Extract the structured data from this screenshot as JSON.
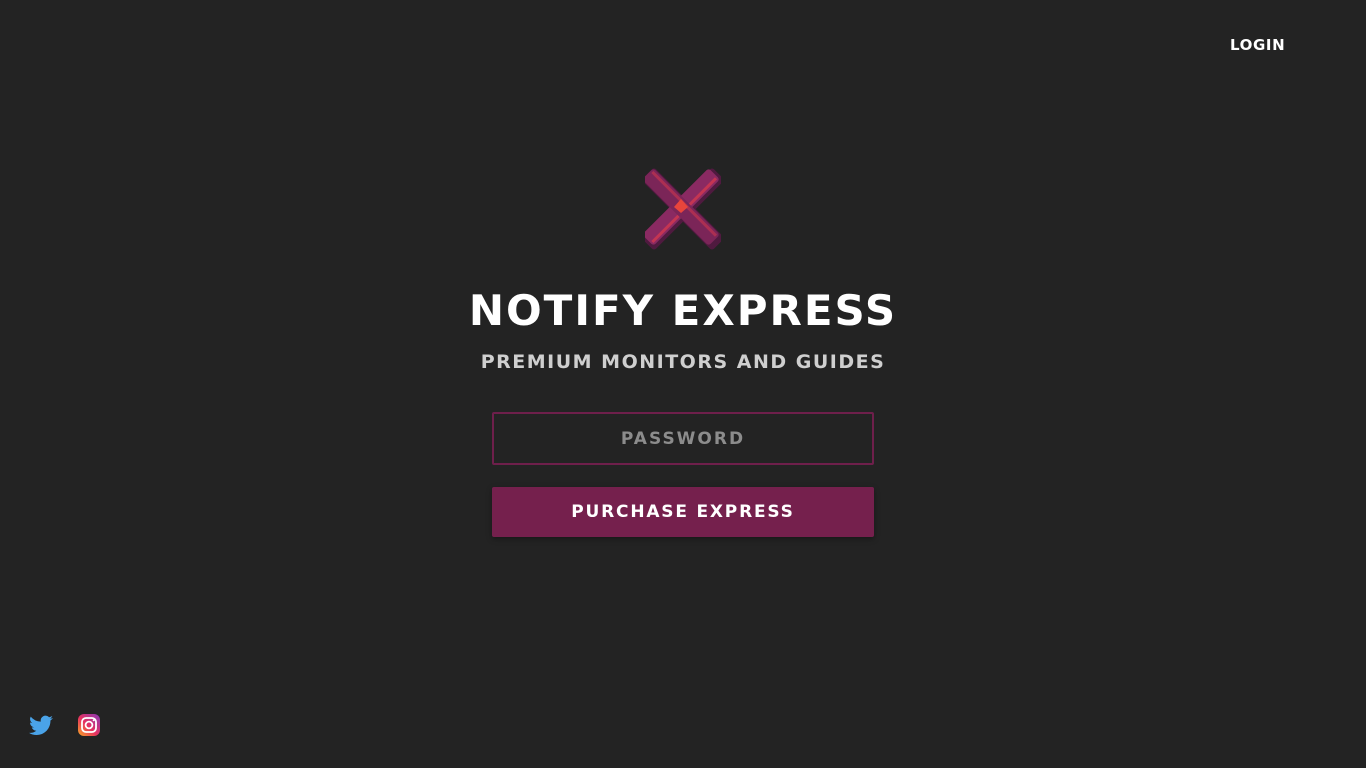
{
  "header": {
    "login_label": "LOGIN"
  },
  "brand": {
    "logo_icon": "x-logo-icon",
    "title": "NOTIFY EXPRESS",
    "subtitle": "PREMIUM MONITORS AND GUIDES",
    "accent_color": "#75204d"
  },
  "form": {
    "password_placeholder": "PASSWORD",
    "password_value": "",
    "purchase_label": "PURCHASE EXPRESS"
  },
  "social": {
    "twitter_icon": "twitter-icon",
    "instagram_icon": "instagram-icon"
  }
}
